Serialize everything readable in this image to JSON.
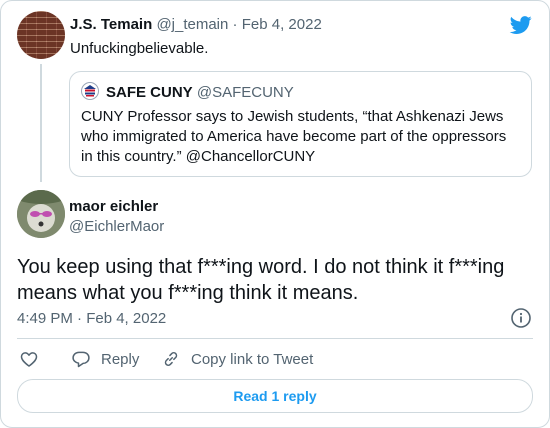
{
  "parent_tweet": {
    "name": "J.S. Temain",
    "handle": "@j_temain",
    "separator": "·",
    "date": "Feb 4, 2022",
    "text": "Unfuckingbelievable."
  },
  "quoted_tweet": {
    "name": "SAFE CUNY",
    "handle": "@SAFECUNY",
    "text_lines": [
      "CUNY Professor says to Jewish students, “that Ashkenazi Jews",
      "who immigrated to America have become part of the oppressors",
      "in this country.” @ChancellorCUNY"
    ]
  },
  "main_tweet": {
    "name": "maor eichler",
    "handle": "@EichlerMaor",
    "text_lines": [
      "You keep using that f***ing word. I do not think it f***ing",
      "means what you f***ing think it means."
    ],
    "timestamp": "4:49 PM · Feb 4, 2022"
  },
  "actions": {
    "reply_label": "Reply",
    "copy_label": "Copy link to Tweet",
    "read_replies_label": "Read 1 reply"
  },
  "icons": {
    "brand": "twitter-bird-icon",
    "like": "heart-icon",
    "reply": "reply-bubble-icon",
    "copy": "link-icon",
    "info": "info-icon"
  },
  "colors": {
    "brand_blue": "#1d9bf0",
    "muted_text": "#536471",
    "border": "#cfd9de"
  }
}
